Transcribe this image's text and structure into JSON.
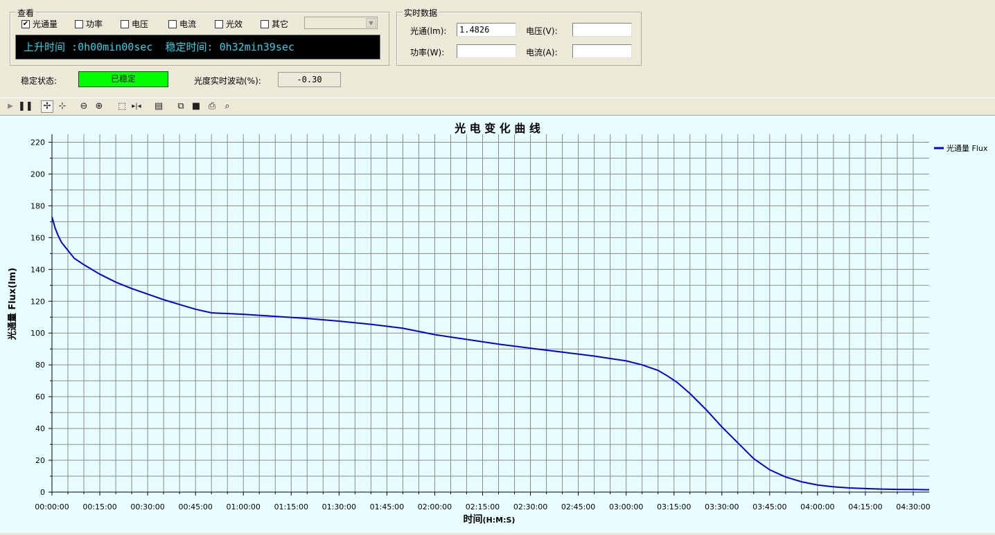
{
  "view_group": {
    "title": "查看",
    "checkboxes": [
      {
        "label": "光通量",
        "checked": true
      },
      {
        "label": "功率",
        "checked": false
      },
      {
        "label": "电压",
        "checked": false
      },
      {
        "label": "电流",
        "checked": false
      },
      {
        "label": "光效",
        "checked": false
      },
      {
        "label": "其它",
        "checked": false
      }
    ],
    "combo_value": "",
    "rise_time_label": "上升时间 :",
    "rise_time_value": "0h00min00sec",
    "stable_time_label": "稳定时间:",
    "stable_time_value": "0h32min39sec"
  },
  "realtime_group": {
    "title": "实时数据",
    "flux_label": "光通(lm):",
    "flux_value": "1.4826",
    "voltage_label": "电压(V):",
    "voltage_value": "",
    "power_label": "功率(W):",
    "power_value": "",
    "current_label": "电流(A):",
    "current_value": ""
  },
  "status": {
    "stable_label": "稳定状态:",
    "stable_value": "已稳定",
    "stable_color": "#00ff00",
    "fluct_label": "光度实时波动(%):",
    "fluct_value": "-0.30"
  },
  "toolbar": {
    "icons": [
      "play-icon",
      "pause-icon",
      "pan-icon",
      "zoom-box-icon",
      "zoom-out-icon",
      "zoom-in-icon",
      "select-rect-icon",
      "fit-icon",
      "properties-icon",
      "copy-icon",
      "save-icon",
      "print-icon",
      "print-preview-icon"
    ]
  },
  "chart_data": {
    "type": "line",
    "title": "光 电 变 化 曲 线",
    "xlabel": "时间",
    "xlabel_unit": "(H:M:S)",
    "ylabel": "光通量 Flux(lm)",
    "ylim": [
      0,
      225
    ],
    "xlim_minutes": [
      0,
      275
    ],
    "yticks": [
      0,
      20,
      40,
      60,
      80,
      100,
      120,
      140,
      160,
      180,
      200,
      220
    ],
    "xtick_labels": [
      "00:00:00",
      "00:15:00",
      "00:30:00",
      "00:45:00",
      "01:00:00",
      "01:15:00",
      "01:30:00",
      "01:45:00",
      "02:00:00",
      "02:15:00",
      "02:30:00",
      "02:45:00",
      "03:00:00",
      "03:15:00",
      "03:30:00",
      "03:45:00",
      "04:00:00",
      "04:15:00",
      "04:30:00"
    ],
    "grid": true,
    "legend_position": "top-right",
    "line_color": "#0000dd",
    "series": [
      {
        "name": "光通量 Flux",
        "x_minutes": [
          0,
          1,
          2,
          3,
          5,
          7,
          10,
          15,
          20,
          25,
          30,
          35,
          40,
          45,
          50,
          52,
          55,
          60,
          70,
          80,
          90,
          100,
          110,
          115,
          120,
          125,
          130,
          140,
          150,
          160,
          170,
          175,
          180,
          185,
          190,
          193,
          196,
          200,
          205,
          210,
          215,
          220,
          225,
          230,
          235,
          240,
          245,
          250,
          255,
          260,
          265,
          270,
          275
        ],
        "y": [
          173,
          166,
          161,
          157,
          152,
          147,
          143,
          137,
          132,
          128,
          124.5,
          121,
          118,
          115,
          112.7,
          112.5,
          112.3,
          111.8,
          110.5,
          109.2,
          107.5,
          105.5,
          103,
          101,
          99,
          97.5,
          96,
          93,
          90.5,
          88,
          85.5,
          84,
          82.5,
          80,
          76.5,
          73,
          69,
          62,
          52,
          41,
          31,
          21,
          14,
          9.5,
          6.5,
          4.5,
          3.3,
          2.6,
          2.2,
          1.9,
          1.7,
          1.6,
          1.5
        ]
      }
    ]
  }
}
